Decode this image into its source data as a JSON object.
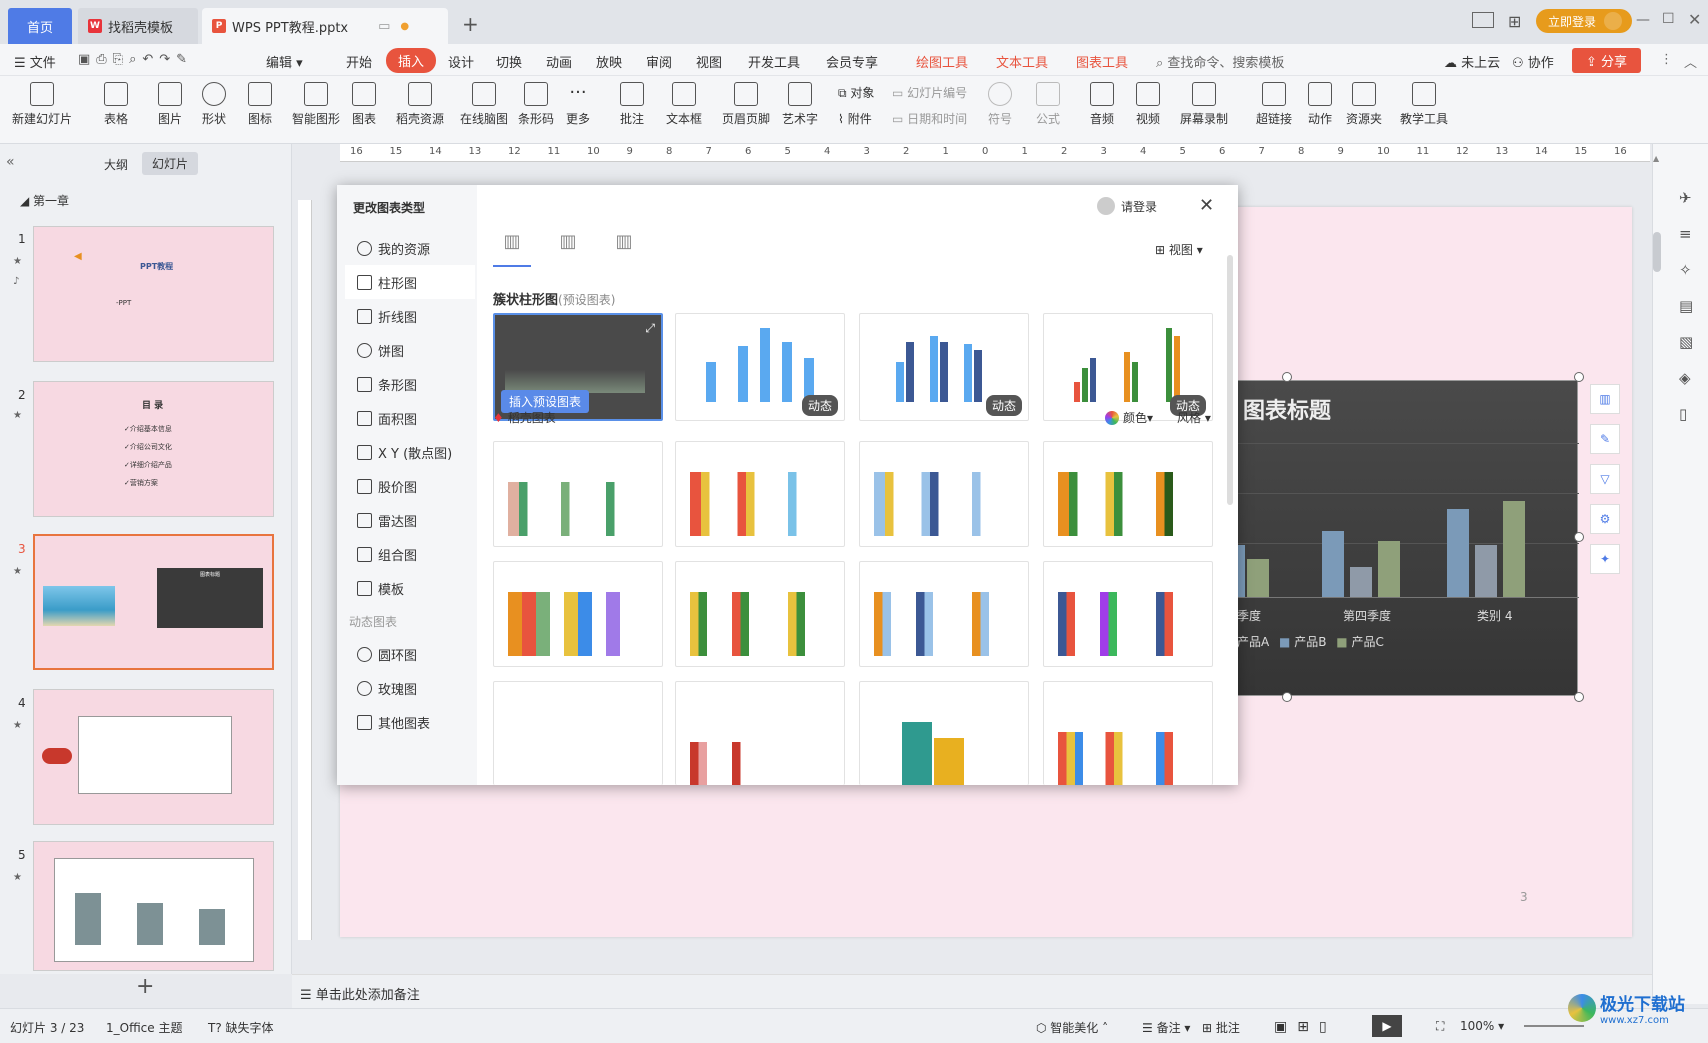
{
  "tabs": {
    "home": "首页",
    "template": "找稻壳模板",
    "active": "WPS PPT教程.pptx",
    "new_tab": "+"
  },
  "titlebar": {
    "login_btn": "立即登录"
  },
  "menubar": {
    "file": "文件",
    "edit": "编辑",
    "items": [
      "开始",
      "插入",
      "设计",
      "切换",
      "动画",
      "放映",
      "审阅",
      "视图",
      "开发工具",
      "会员专享"
    ],
    "ctx_draw": "绘图工具",
    "ctx_text": "文本工具",
    "ctx_chart": "图表工具",
    "search": "查找命令、搜索模板",
    "cloud": "未上云",
    "collab": "协作",
    "share": "分享"
  },
  "ribbon": {
    "items": [
      "新建幻灯片",
      "表格",
      "图片",
      "形状",
      "图标",
      "智能图形",
      "图表",
      "稻壳资源",
      "在线脑图",
      "条形码",
      "更多",
      "批注",
      "文本框",
      "页眉页脚",
      "艺术字"
    ],
    "object": "对象",
    "attach": "附件",
    "slide_no": "幻灯片编号",
    "datetime": "日期和时间",
    "symbol": "符号",
    "formula": "公式",
    "items2": [
      "音频",
      "视频",
      "屏幕录制",
      "超链接",
      "动作",
      "资源夹",
      "教学工具"
    ]
  },
  "ruler": {
    "labels": [
      "16",
      "15",
      "14",
      "13",
      "12",
      "11",
      "10",
      "9",
      "8",
      "7",
      "6",
      "5",
      "4",
      "3",
      "2",
      "1",
      "0",
      "1",
      "2",
      "3",
      "4",
      "5",
      "6",
      "7",
      "8",
      "9",
      "10",
      "11",
      "12",
      "13",
      "14",
      "15",
      "16"
    ]
  },
  "leftpane": {
    "tab_outline": "大纲",
    "tab_slides": "幻灯片",
    "section": "第一章",
    "slides": [
      {
        "num": "1",
        "title": "PPT教程",
        "sub": "-PPT"
      },
      {
        "num": "2",
        "title": "目 录",
        "lines": [
          "✓介绍基本信息",
          "✓介绍公司文化",
          "✓详细介绍产品",
          "✓营销方案"
        ]
      },
      {
        "num": "3",
        "chart_title": "图表标题"
      },
      {
        "num": "4"
      },
      {
        "num": "5"
      }
    ],
    "add": "+"
  },
  "slide": {
    "chart_title": "图表标题",
    "axis_labels": [
      "季度",
      "第四季度",
      "类别 4"
    ],
    "legend": [
      "产品A",
      "产品B",
      "产品C"
    ],
    "page_no": "3"
  },
  "dialog": {
    "title": "更改图表类型",
    "login": "请登录",
    "view": "视图",
    "sidebar": [
      "我的资源",
      "柱形图",
      "折线图",
      "饼图",
      "条形图",
      "面积图",
      "X Y (散点图)",
      "股价图",
      "雷达图",
      "组合图",
      "模板"
    ],
    "dynamic_header": "动态图表",
    "sidebar2": [
      "圆环图",
      "玫瑰图",
      "其他图表"
    ],
    "section1": "簇状柱形图",
    "section1_sub": "(预设图表)",
    "insert_btn": "插入预设图表",
    "dynamic_badge": "动态",
    "section2": "稻壳图表",
    "color": "颜色",
    "style": "风格"
  },
  "notes": {
    "placeholder": "单击此处添加备注"
  },
  "status": {
    "slide": "幻灯片 3 / 23",
    "theme": "1_Office 主题",
    "font": "缺失字体",
    "beautify": "智能美化",
    "notes": "备注",
    "comment": "批注",
    "zoom": "100%"
  },
  "watermark": {
    "brand": "极光下载站",
    "url": "www.xz7.com"
  },
  "colors": {
    "accent": "#4f7be6",
    "insert_tab": "#e8543e",
    "ctx": "#e8543e",
    "blue": "#5aa9f0",
    "navy": "#3c5894"
  }
}
